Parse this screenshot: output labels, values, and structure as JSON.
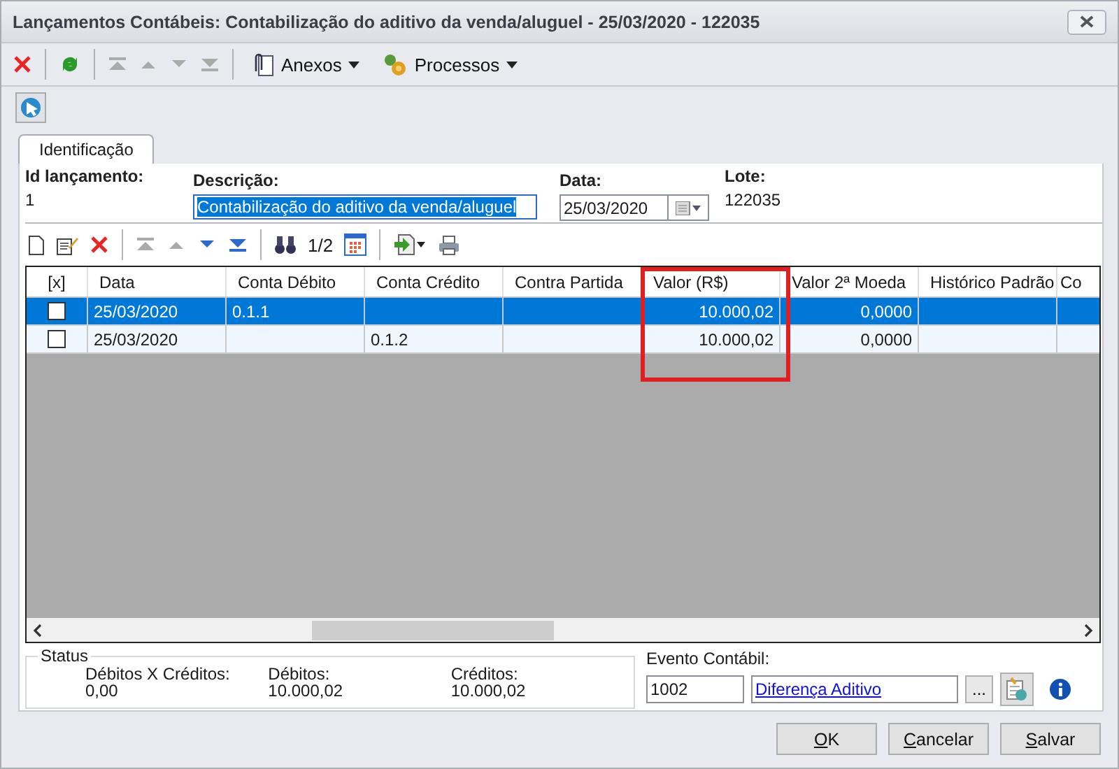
{
  "window": {
    "title": "Lançamentos Contábeis: Contabilização do aditivo da venda/aluguel - 25/03/2020 - 122035"
  },
  "toolbar": {
    "attachments": "Anexos",
    "processes": "Processos"
  },
  "tab": {
    "label": "Identificação",
    "selected": true
  },
  "fields": {
    "id": {
      "label": "Id lançamento:",
      "value": "1"
    },
    "description": {
      "label": "Descrição:",
      "value": "Contabilização do aditivo da venda/aluguel",
      "text_selected": true
    },
    "date": {
      "label": "Data:",
      "value": "25/03/2020"
    },
    "batch": {
      "label": "Lote:",
      "value": "122035"
    }
  },
  "grid_toolbar": {
    "page": "1/2"
  },
  "table": {
    "columns": [
      {
        "label": "[x]",
        "highlighted": false
      },
      {
        "label": "Data",
        "highlighted": false
      },
      {
        "label": "Conta Débito",
        "highlighted": false
      },
      {
        "label": "Conta Crédito",
        "highlighted": false
      },
      {
        "label": "Contra Partida",
        "highlighted": false
      },
      {
        "label": "Valor (R$)",
        "highlighted": true
      },
      {
        "label": "Valor 2ª Moeda",
        "highlighted": false
      },
      {
        "label": "Histórico Padrão",
        "highlighted": false
      },
      {
        "label": "Co",
        "highlighted": false
      }
    ],
    "rows": [
      {
        "selected": true,
        "checked": false,
        "cells": [
          "",
          "25/03/2020",
          "0.1.1",
          "",
          "",
          "10.000,02",
          "0,0000",
          "",
          ""
        ]
      },
      {
        "selected": false,
        "checked": false,
        "cells": [
          "",
          "25/03/2020",
          "",
          "0.1.2",
          "",
          "10.000,02",
          "0,0000",
          "",
          ""
        ]
      }
    ]
  },
  "status": {
    "legend": "Status",
    "items": [
      {
        "label": "Débitos X Créditos:",
        "value": "0,00"
      },
      {
        "label": "Débitos:",
        "value": "10.000,02"
      },
      {
        "label": "Créditos:",
        "value": "10.000,02"
      }
    ]
  },
  "event": {
    "label": "Evento Contábil:",
    "code": "1002",
    "link": "Diferença Aditivo",
    "browse": "..."
  },
  "buttons": [
    {
      "label": "OK",
      "underline_first": true
    },
    {
      "label": "Cancelar",
      "underline_first": true
    },
    {
      "label": "Salvar",
      "underline_first": true
    }
  ]
}
